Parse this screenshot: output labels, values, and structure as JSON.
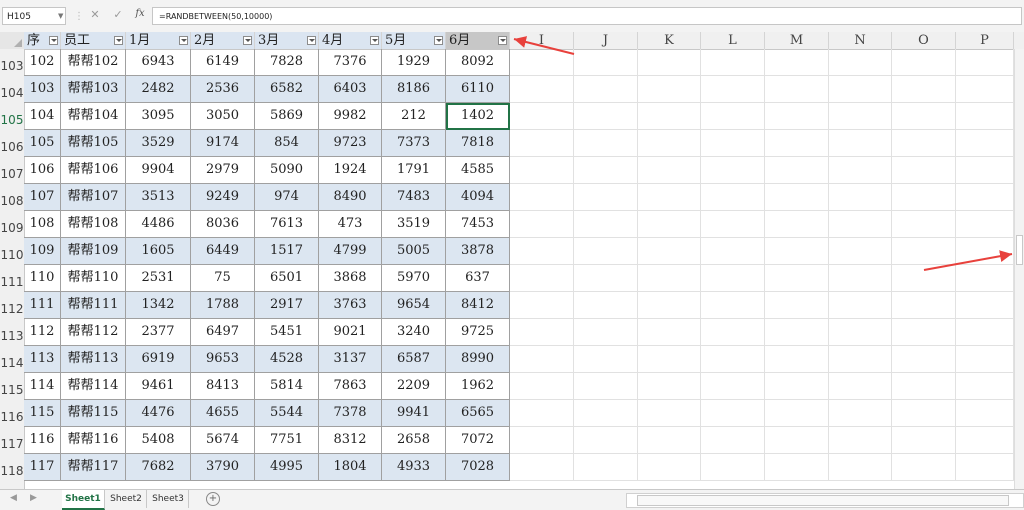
{
  "formula_bar": {
    "cell_ref": "H105",
    "fx": "fx",
    "cancel": "✕",
    "enter": "✓",
    "formula": "=RANDBETWEEN(50,10000)"
  },
  "columns": [
    {
      "id": "A",
      "label": "序",
      "filter": true
    },
    {
      "id": "B",
      "label": "员工",
      "filter": true
    },
    {
      "id": "C",
      "label": "1月",
      "filter": true
    },
    {
      "id": "D",
      "label": "2月",
      "filter": true
    },
    {
      "id": "E",
      "label": "3月",
      "filter": true
    },
    {
      "id": "F",
      "label": "4月",
      "filter": true
    },
    {
      "id": "G",
      "label": "5月",
      "filter": true
    },
    {
      "id": "H",
      "label": "6月",
      "filter": true
    },
    {
      "id": "I",
      "label": "I",
      "filter": false
    },
    {
      "id": "J",
      "label": "J",
      "filter": false
    },
    {
      "id": "K",
      "label": "K",
      "filter": false
    },
    {
      "id": "L",
      "label": "L",
      "filter": false
    },
    {
      "id": "M",
      "label": "M",
      "filter": false
    },
    {
      "id": "N",
      "label": "N",
      "filter": false
    },
    {
      "id": "O",
      "label": "O",
      "filter": false
    },
    {
      "id": "P",
      "label": "P",
      "filter": false
    }
  ],
  "row_numbers": [
    "103",
    "104",
    "105",
    "106",
    "107",
    "108",
    "109",
    "110",
    "111",
    "112",
    "113",
    "114",
    "115",
    "116",
    "117",
    "118"
  ],
  "rows": [
    [
      "102",
      "帮帮102",
      "6943",
      "6149",
      "7828",
      "7376",
      "1929",
      "8092"
    ],
    [
      "103",
      "帮帮103",
      "2482",
      "2536",
      "6582",
      "6403",
      "8186",
      "6110"
    ],
    [
      "104",
      "帮帮104",
      "3095",
      "3050",
      "5869",
      "9982",
      "212",
      "1402"
    ],
    [
      "105",
      "帮帮105",
      "3529",
      "9174",
      "854",
      "9723",
      "7373",
      "7818"
    ],
    [
      "106",
      "帮帮106",
      "9904",
      "2979",
      "5090",
      "1924",
      "1791",
      "4585"
    ],
    [
      "107",
      "帮帮107",
      "3513",
      "9249",
      "974",
      "8490",
      "7483",
      "4094"
    ],
    [
      "108",
      "帮帮108",
      "4486",
      "8036",
      "7613",
      "473",
      "3519",
      "7453"
    ],
    [
      "109",
      "帮帮109",
      "1605",
      "6449",
      "1517",
      "4799",
      "5005",
      "3878"
    ],
    [
      "110",
      "帮帮110",
      "2531",
      "75",
      "6501",
      "3868",
      "5970",
      "637"
    ],
    [
      "111",
      "帮帮111",
      "1342",
      "1788",
      "2917",
      "3763",
      "9654",
      "8412"
    ],
    [
      "112",
      "帮帮112",
      "2377",
      "6497",
      "5451",
      "9021",
      "3240",
      "9725"
    ],
    [
      "113",
      "帮帮113",
      "6919",
      "9653",
      "4528",
      "3137",
      "6587",
      "8990"
    ],
    [
      "114",
      "帮帮114",
      "9461",
      "8413",
      "5814",
      "7863",
      "2209",
      "1962"
    ],
    [
      "115",
      "帮帮115",
      "4476",
      "4655",
      "5544",
      "7378",
      "9941",
      "6565"
    ],
    [
      "116",
      "帮帮116",
      "5408",
      "5674",
      "7751",
      "8312",
      "2658",
      "7072"
    ],
    [
      "117",
      "帮帮117",
      "7682",
      "3790",
      "4995",
      "1804",
      "4933",
      "7028"
    ]
  ],
  "active_cell": {
    "row": "105",
    "column": "H"
  },
  "sheet_tabs": [
    {
      "label": "Sheet1",
      "active": true
    },
    {
      "label": "Sheet2",
      "active": false
    },
    {
      "label": "Sheet3",
      "active": false
    }
  ],
  "add_sheet": "+",
  "colors": {
    "accent": "#217346",
    "table_band": "#dce6f1",
    "annotation_arrow": "#e8413c"
  }
}
